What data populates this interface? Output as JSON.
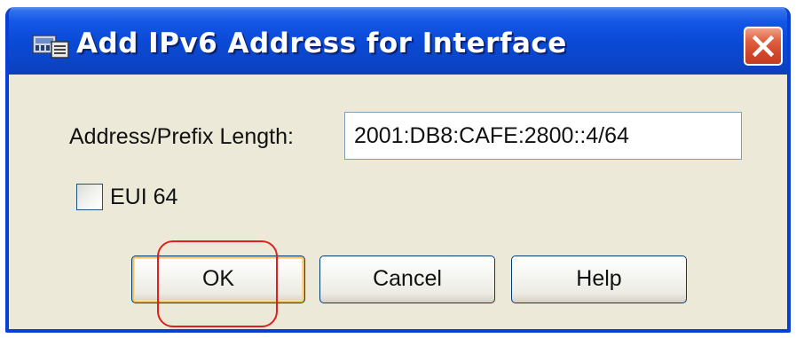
{
  "window": {
    "title": "Add IPv6 Address for Interface",
    "title_bar_color": "#0a4ad6",
    "app_icon": "network-interface-icon",
    "close_icon": "close-icon"
  },
  "form": {
    "address_label": "Address/Prefix Length:",
    "address_value": "2001:DB8:CAFE:2800::4/64",
    "eui64_label": "EUI 64",
    "eui64_checked": false
  },
  "buttons": {
    "ok_label": "OK",
    "cancel_label": "Cancel",
    "help_label": "Help"
  },
  "annotation": {
    "highlight_color": "#e02020",
    "highlight_target": "OK"
  }
}
